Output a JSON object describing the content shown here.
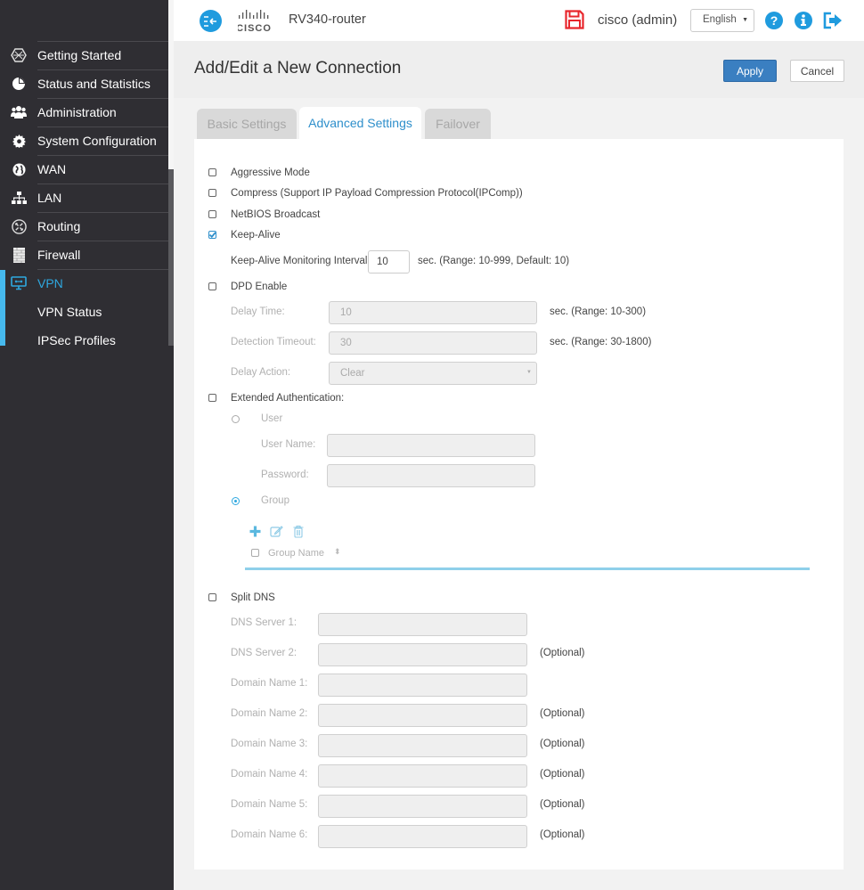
{
  "sidebar": {
    "items": [
      {
        "label": "Getting Started",
        "icon": "globe-hex-icon"
      },
      {
        "label": "Status and Statistics",
        "icon": "pie-chart-icon"
      },
      {
        "label": "Administration",
        "icon": "users-icon"
      },
      {
        "label": "System Configuration",
        "icon": "gear-icon"
      },
      {
        "label": "WAN",
        "icon": "globe-icon"
      },
      {
        "label": "LAN",
        "icon": "network-icon"
      },
      {
        "label": "Routing",
        "icon": "router-icon"
      },
      {
        "label": "Firewall",
        "icon": "firewall-icon"
      },
      {
        "label": "VPN",
        "icon": "vpn-monitor-icon",
        "active": true
      }
    ],
    "subitems": [
      {
        "label": "VPN Status"
      },
      {
        "label": "IPSec Profiles"
      }
    ],
    "active_color": "#2ea8e0"
  },
  "header": {
    "brand": "CISCO",
    "device_name": "RV340-router",
    "user": "cisco (admin)",
    "language": "English"
  },
  "page": {
    "title": "Add/Edit a New Connection",
    "apply_label": "Apply",
    "cancel_label": "Cancel"
  },
  "tabs": [
    {
      "label": "Basic Settings",
      "active": false
    },
    {
      "label": "Advanced Settings",
      "active": true
    },
    {
      "label": "Failover",
      "active": false
    }
  ],
  "advanced": {
    "aggressive_mode": {
      "label": "Aggressive Mode",
      "checked": false
    },
    "compress": {
      "label": "Compress (Support IP Payload Compression Protocol(IPComp))",
      "checked": false
    },
    "netbios": {
      "label": "NetBIOS Broadcast",
      "checked": false
    },
    "keep_alive": {
      "label": "Keep-Alive",
      "checked": true
    },
    "keep_alive_interval": {
      "label": "Keep-Alive Monitoring Interval",
      "value": "10",
      "hint": "sec. (Range: 10-999, Default: 10)"
    },
    "dpd": {
      "label": "DPD Enable",
      "checked": false
    },
    "delay_time": {
      "label": "Delay Time:",
      "value": "10",
      "hint": "sec. (Range: 10-300)"
    },
    "detection_timeout": {
      "label": "Detection Timeout:",
      "value": "30",
      "hint": "sec. (Range: 30-1800)"
    },
    "delay_action": {
      "label": "Delay Action:",
      "value": "Clear"
    },
    "xauth": {
      "label": "Extended Authentication:",
      "checked": false
    },
    "user_radio": {
      "label": "User",
      "checked": false
    },
    "user_name": {
      "label": "User Name:",
      "value": ""
    },
    "password": {
      "label": "Password:",
      "value": ""
    },
    "group_radio": {
      "label": "Group",
      "checked": true
    },
    "group_table": {
      "column": "Group Name"
    },
    "split_dns": {
      "label": "Split DNS",
      "checked": false
    },
    "dns_fields": [
      {
        "label": "DNS Server 1:",
        "value": "",
        "hint": ""
      },
      {
        "label": "DNS Server 2:",
        "value": "",
        "hint": "(Optional)"
      },
      {
        "label": "Domain Name 1:",
        "value": "",
        "hint": ""
      },
      {
        "label": "Domain Name 2:",
        "value": "",
        "hint": "(Optional)"
      },
      {
        "label": "Domain Name 3:",
        "value": "",
        "hint": "(Optional)"
      },
      {
        "label": "Domain Name 4:",
        "value": "",
        "hint": "(Optional)"
      },
      {
        "label": "Domain Name 5:",
        "value": "",
        "hint": "(Optional)"
      },
      {
        "label": "Domain Name 6:",
        "value": "",
        "hint": "(Optional)"
      }
    ]
  },
  "colors": {
    "accent": "#2ea8e0",
    "apply": "#3a7fc1",
    "save_icon": "#e8262c"
  }
}
